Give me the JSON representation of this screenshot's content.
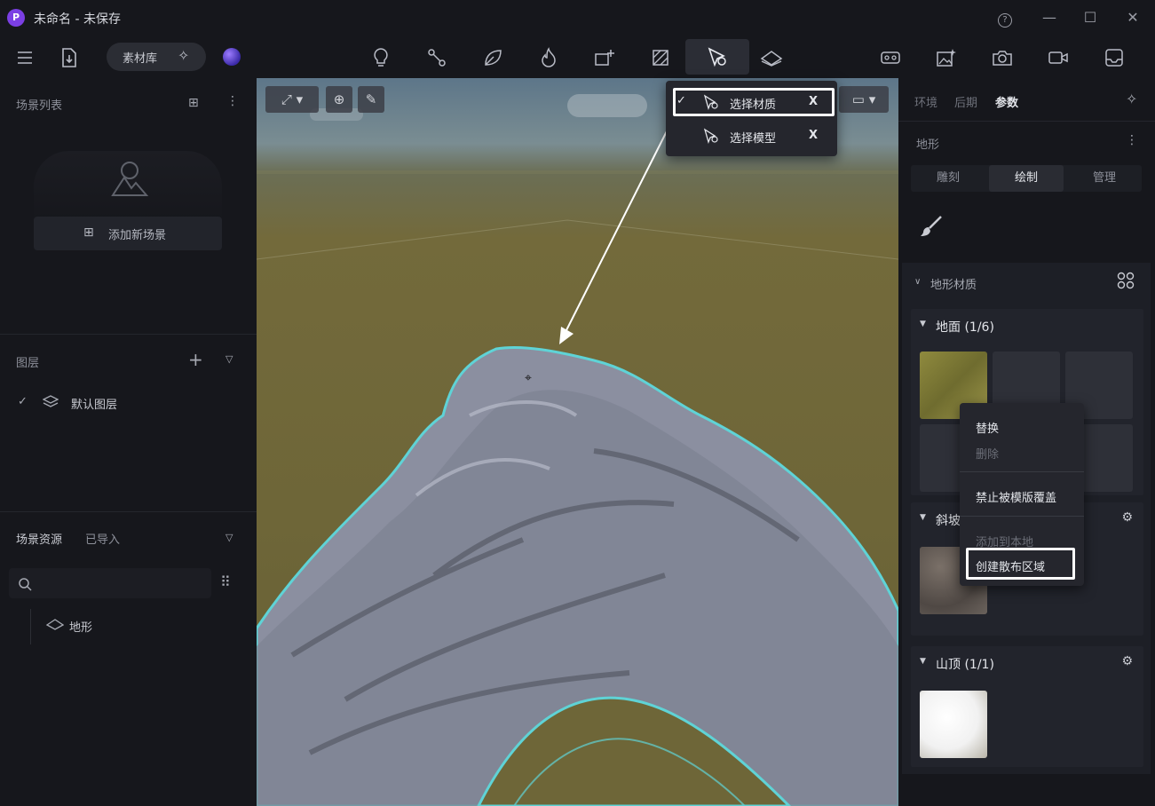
{
  "window": {
    "logo_glyph": "P",
    "title": "未命名 - 未保存",
    "help_glyph": "?",
    "minimize_glyph": "—",
    "maximize_glyph": "☐",
    "close_glyph": "✕"
  },
  "toolbar": {
    "library_label": "素材库",
    "tools": [
      "light-bulb-icon",
      "path-icon",
      "leaf-icon",
      "fire-icon",
      "add-object-icon",
      "texture-icon",
      "select-material-icon",
      "terrain-icon"
    ],
    "right_tools": [
      "vr-headset-icon",
      "ai-image-icon",
      "camera-icon",
      "video-icon",
      "inbox-icon"
    ]
  },
  "left_panel": {
    "scene_list_title": "场景列表",
    "add_scene_label": "添加新场景",
    "layers_title": "图层",
    "default_layer_label": "默认图层",
    "assets_title": "场景资源",
    "assets_subtitle": "已导入",
    "terrain_item_label": "地形"
  },
  "select_menu": {
    "items": [
      {
        "label": "选择材质",
        "shortcut": "X",
        "checked": true
      },
      {
        "label": "选择模型",
        "shortcut": "X",
        "checked": false
      }
    ]
  },
  "right_panel": {
    "tabs": [
      {
        "label": "环境",
        "active": false
      },
      {
        "label": "后期",
        "active": false
      },
      {
        "label": "参数",
        "active": true
      }
    ],
    "section_title": "地形",
    "segments": [
      {
        "label": "雕刻",
        "active": false
      },
      {
        "label": "绘制",
        "active": true
      },
      {
        "label": "管理",
        "active": false
      }
    ],
    "terrain_material_title": "地形材质",
    "groups": [
      {
        "label": "地面 (1/6)"
      },
      {
        "label": "斜坡"
      },
      {
        "label": "山顶 (1/1)"
      }
    ]
  },
  "context_menu": {
    "items": [
      {
        "label": "替换",
        "disabled": false
      },
      {
        "label": "删除",
        "disabled": true
      },
      {
        "label": "禁止被模版覆盖",
        "disabled": false
      },
      {
        "label": "添加到本地",
        "disabled": true
      },
      {
        "label": "创建散布区域",
        "disabled": false,
        "highlighted": true
      }
    ]
  },
  "colors": {
    "accent_purple": "#7b3fe4",
    "highlight_border": "#ffffff",
    "terrain_outline": "#5fd3d6"
  }
}
